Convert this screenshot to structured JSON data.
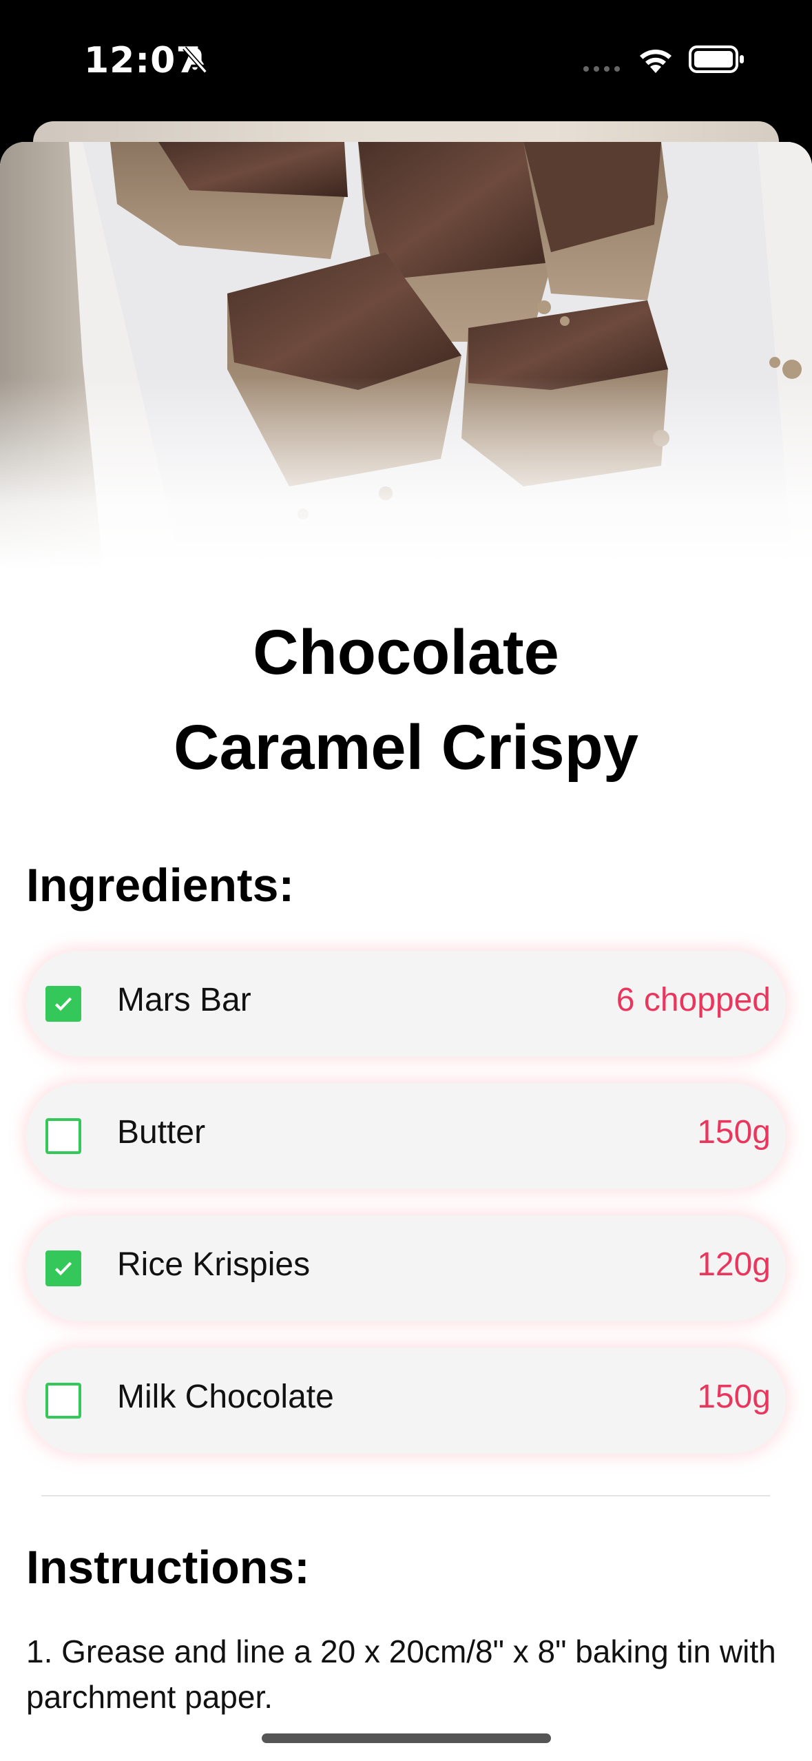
{
  "status_bar": {
    "time": "12:07"
  },
  "recipe": {
    "title_line1": "Chocolate",
    "title_line2": "Caramel Crispy",
    "hero_image": "chocolate-crispy-squares-photo"
  },
  "ingredients": {
    "heading": "Ingredients:",
    "items": [
      {
        "name": "Mars Bar",
        "quantity": "6 chopped",
        "checked": true
      },
      {
        "name": "Butter",
        "quantity": "150g",
        "checked": false
      },
      {
        "name": "Rice Krispies",
        "quantity": "120g",
        "checked": true
      },
      {
        "name": "Milk Chocolate",
        "quantity": "150g",
        "checked": false
      }
    ]
  },
  "instructions": {
    "heading": "Instructions:",
    "steps": [
      "1. Grease and line a 20 x 20cm/8\" x 8\" baking tin with parchment paper."
    ]
  },
  "colors": {
    "accent": "#e8365d",
    "check": "#34c759"
  }
}
